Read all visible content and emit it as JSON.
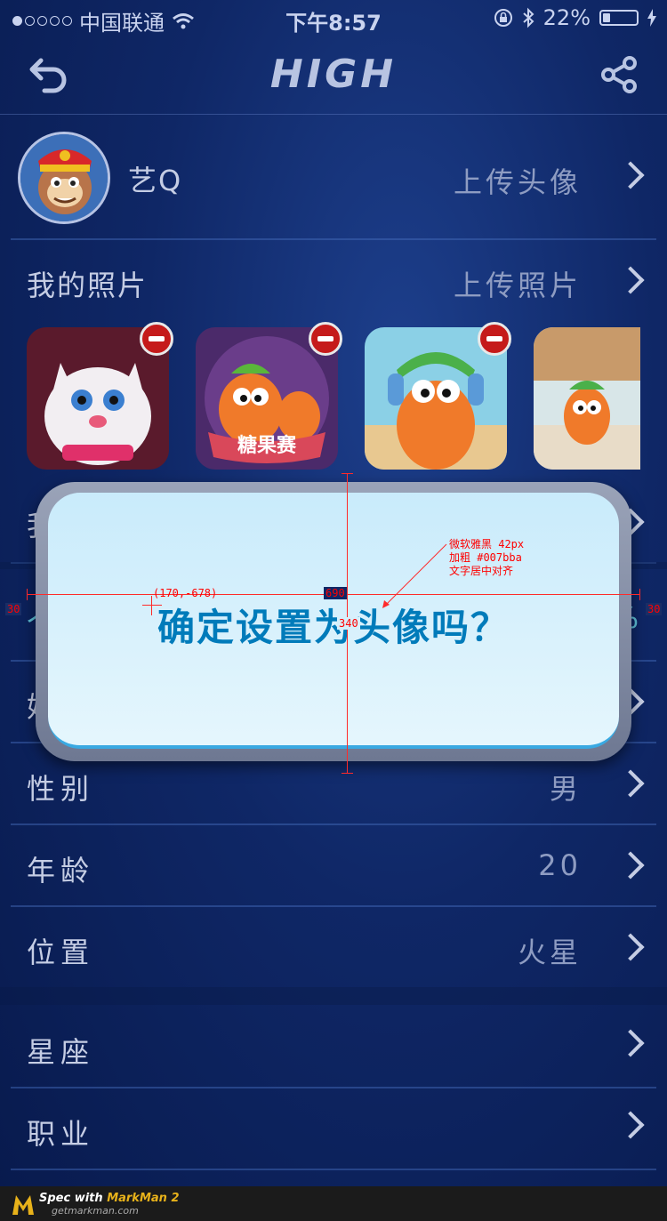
{
  "status_bar": {
    "carrier": "中国联通",
    "time": "下午8:57",
    "battery": "22%",
    "battery_level": 0.22
  },
  "nav": {
    "title": "HIGH",
    "back_icon": "back-arrow-icon",
    "share_icon": "share-icon"
  },
  "profile": {
    "nickname": "艺Q",
    "upload_avatar": "上传头像"
  },
  "photos": {
    "label": "我的照片",
    "upload": "上传照片",
    "items": [
      {
        "name": "white-cat-photo"
      },
      {
        "name": "carrot-candy-photo",
        "caption": "糖果赛"
      },
      {
        "name": "carrot-headphones-photo"
      },
      {
        "name": "carrot-running-photo"
      }
    ]
  },
  "hidden_rows": {
    "row1_label": "我",
    "row2_label": "个",
    "row2_value": "%",
    "row3_label": "姓"
  },
  "rows": [
    {
      "label": "性别",
      "value": "男"
    },
    {
      "label": "年龄",
      "value": "20"
    },
    {
      "label": "位置",
      "value": "火星"
    },
    {
      "label": "星座",
      "value": ""
    },
    {
      "label": "职业",
      "value": ""
    }
  ],
  "dialog": {
    "message": "确定设置为头像吗？"
  },
  "annotations": {
    "coord": "(170,-678)",
    "width": "690",
    "height": "340",
    "left_margin": "30",
    "right_margin": "30",
    "note_line1": "微软雅黑 42px",
    "note_line2": "加粗  #007bba",
    "note_line3": "文字居中对齐"
  },
  "footer": {
    "brand_prefix": "Spec with ",
    "brand": "MarkMan 2",
    "url": "getmarkman.com"
  },
  "colors": {
    "dialog_text": "#007bba",
    "annotation": "#ff0000",
    "minus_badge": "#c51a1a"
  }
}
